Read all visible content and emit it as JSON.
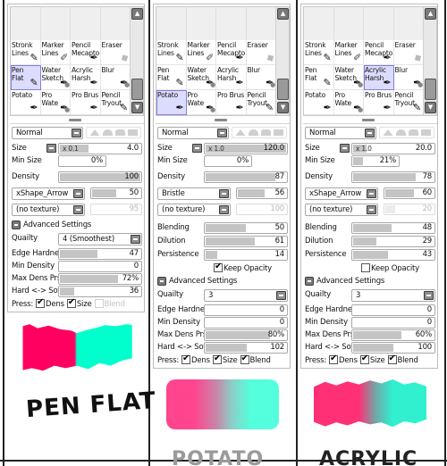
{
  "brush_grid": {
    "cells": [
      {
        "label": "Stronk\nLines",
        "icon": "pencil-icon"
      },
      {
        "label": "Marker\nLines",
        "icon": "marker-icon"
      },
      {
        "label": "Pencil\nMecapto",
        "icon": "pen-icon"
      },
      {
        "label": "Eraser",
        "icon": "eraser-icon"
      },
      {
        "label": "Pen\nFlat",
        "icon": "pencil-icon"
      },
      {
        "label": "Water\nSketch",
        "icon": "brush-water-icon"
      },
      {
        "label": "Acrylic\nHarsh",
        "icon": "brush-icon"
      },
      {
        "label": "Blur",
        "icon": "brush-water-icon"
      },
      {
        "label": "Potato",
        "icon": "brush-icon"
      },
      {
        "label": "Pro Wate",
        "icon": "brush-water-icon"
      },
      {
        "label": "Pro Brus",
        "icon": "brush-icon"
      },
      {
        "label": "Pencil\nTryout",
        "icon": "pencil-icon"
      }
    ]
  },
  "labels": {
    "size": "Size",
    "min_size": "Min Size",
    "density": "Density",
    "blending": "Blending",
    "dilution": "Dilution",
    "persistence": "Persistence",
    "keep_opacity": "Keep Opacity",
    "advanced_settings": "Advanced Settings",
    "quality": "Quailty",
    "edge_hardness": "Edge Hardness",
    "min_density": "Min Density",
    "max_dens_prs": "Max Dens Prs.",
    "hard_soft": "Hard <-> Soft",
    "press": "Press:",
    "dens": "Dens",
    "size_chk": "Size",
    "blend": "Blend"
  },
  "panels": [
    {
      "name": "Pen Flat",
      "selected_cell": 4,
      "blend_mode": "Normal",
      "size_multiplier": "x 0.1",
      "size_value": "4.0",
      "size_fill": 0.35,
      "min_size": "0%",
      "min_size_fill": 0,
      "density": "100",
      "density_fill": 1.0,
      "shape": "xShape_Arrow",
      "shape_value": "50",
      "shape_fill": 0.5,
      "texture": "(no texture)",
      "texture_value": "95",
      "texture_fill": 0.0,
      "texture_disabled": true,
      "has_blending": false,
      "quality": "4 (Smoothest)",
      "edge_hardness": "47",
      "edge_hardness_fill": 0.47,
      "min_density": "0",
      "min_density_fill": 0,
      "max_dens_prs": "72%",
      "max_dens_prs_fill": 0.72,
      "hard_soft": "36",
      "hard_soft_fill": 0.18,
      "press_dens": true,
      "press_size": true,
      "press_blend": false,
      "press_blend_disabled": true,
      "caption": "PEN FLAT",
      "caption_color": "#111111",
      "stroke_colors": [
        "#ff0060",
        "#00ffcc"
      ]
    },
    {
      "name": "Potato",
      "selected_cell": 8,
      "blend_mode": "Normal",
      "size_multiplier": "x 1.0",
      "size_value": "120.0",
      "size_fill": 1.0,
      "min_size": "0%",
      "min_size_fill": 0,
      "density": "87",
      "density_fill": 0.87,
      "shape": "Bristle",
      "shape_value": "56",
      "shape_fill": 0.56,
      "texture": "(no texture)",
      "texture_value": "100",
      "texture_fill": 0.0,
      "texture_disabled": true,
      "has_blending": true,
      "blending": "50",
      "blending_fill": 0.5,
      "dilution": "61",
      "dilution_fill": 0.61,
      "persistence": "14",
      "persistence_fill": 0.14,
      "keep_opacity": true,
      "quality": "3",
      "edge_hardness": "0",
      "edge_hardness_fill": 0,
      "min_density": "0",
      "min_density_fill": 0,
      "max_dens_prs": "80%",
      "max_dens_prs_fill": 0.8,
      "hard_soft": "102",
      "hard_soft_fill": 0.51,
      "press_dens": true,
      "press_size": true,
      "press_blend": true,
      "press_blend_disabled": false,
      "caption": "POTATO",
      "caption_color": "#9a9a9a",
      "stroke_colors": [
        "#ff3080",
        "#40ffd8"
      ]
    },
    {
      "name": "Acrylic",
      "selected_cell": 6,
      "blend_mode": "Normal",
      "size_multiplier": "x 1.0",
      "size_value": "20.0",
      "size_fill": 0.17,
      "min_size": "21%",
      "min_size_fill": 0.21,
      "density": "78",
      "density_fill": 0.78,
      "shape": "xShape_Arrow",
      "shape_value": "60",
      "shape_fill": 0.6,
      "texture": "(no texture)",
      "texture_value": "20",
      "texture_fill": 0.2,
      "texture_disabled": true,
      "has_blending": true,
      "blending": "48",
      "blending_fill": 0.48,
      "dilution": "29",
      "dilution_fill": 0.29,
      "persistence": "43",
      "persistence_fill": 0.43,
      "keep_opacity": false,
      "quality": "3",
      "edge_hardness": "0",
      "edge_hardness_fill": 0,
      "min_density": "0",
      "min_density_fill": 0,
      "max_dens_prs": "60%",
      "max_dens_prs_fill": 0.6,
      "hard_soft": "100",
      "hard_soft_fill": 0.5,
      "press_dens": true,
      "press_size": true,
      "press_blend": true,
      "press_blend_disabled": false,
      "caption": "ACRYLIC",
      "caption_color": "#222222",
      "stroke_colors": [
        "#ff3075",
        "#30f0d0"
      ]
    }
  ]
}
